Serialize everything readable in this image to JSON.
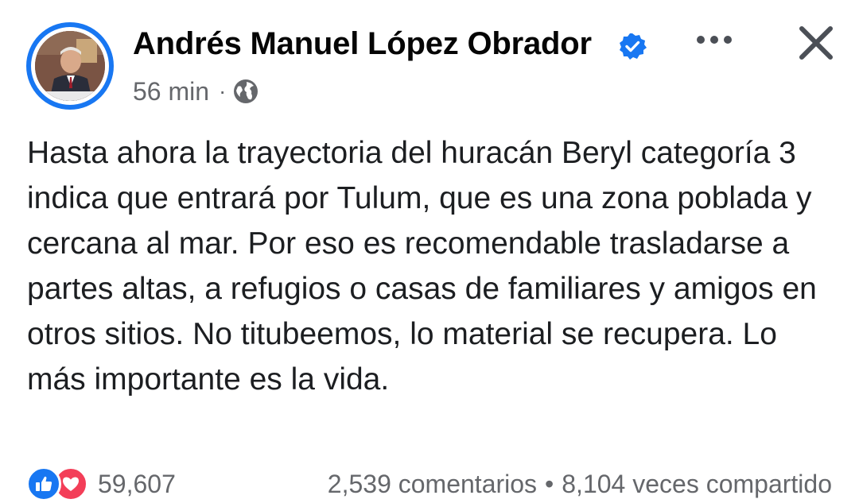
{
  "post": {
    "author": "Andrés Manuel López Obrador",
    "time": "56 min",
    "separator": "·",
    "text": "Hasta ahora la trayectoria del huracán Beryl categoría 3 indica que entrará por Tulum, que es una zona poblada y cercana al mar. Por eso es recomendable trasladarse a partes altas, a refugios o casas de familiares y amigos en otros sitios. No titubeemos, lo material se recupera. Lo más importante es la vida."
  },
  "icons": {
    "verified": "verified-badge-icon",
    "audience": "globe-icon",
    "more": "more-icon",
    "close": "close-icon",
    "like": "like-icon",
    "love": "love-icon"
  },
  "footer": {
    "reaction_count": "59,607",
    "comments": "2,539 comentarios",
    "dot": "•",
    "shares": "8,104 veces compartido"
  },
  "colors": {
    "accent": "#1877f2",
    "love": "#f33e58",
    "secondary_text": "#65676b"
  }
}
